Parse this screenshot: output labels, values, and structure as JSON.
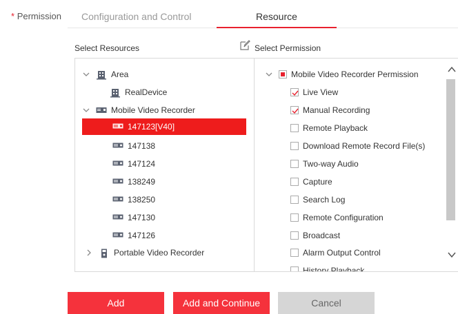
{
  "form": {
    "required_mark": "*",
    "field_label": "Permission"
  },
  "tabs": [
    {
      "label": "Configuration and Control",
      "active": false
    },
    {
      "label": "Resource",
      "active": true
    }
  ],
  "left_panel": {
    "title": "Select Resources",
    "tree": [
      {
        "label": "Area",
        "icon": "area-icon",
        "expanded": true
      },
      {
        "label": "RealDevice",
        "icon": "area-icon"
      },
      {
        "label": "Mobile Video Recorder",
        "icon": "mobile-recorder-icon",
        "expanded": true
      },
      {
        "label": "147123[V40]",
        "icon": "device-icon",
        "selected": true
      },
      {
        "label": "147138",
        "icon": "device-icon"
      },
      {
        "label": "147124",
        "icon": "device-icon"
      },
      {
        "label": "138249",
        "icon": "device-icon"
      },
      {
        "label": "138250",
        "icon": "device-icon"
      },
      {
        "label": "147130",
        "icon": "device-icon"
      },
      {
        "label": "147126",
        "icon": "device-icon"
      },
      {
        "label": "Portable Video Recorder",
        "icon": "portable-recorder-icon",
        "expanded": false
      }
    ]
  },
  "right_panel": {
    "title": "Select Permission",
    "root": {
      "label": "Mobile Video Recorder Permission",
      "state": "partial",
      "expanded": true
    },
    "permissions": [
      {
        "label": "Live View",
        "checked": true
      },
      {
        "label": "Manual Recording",
        "checked": true
      },
      {
        "label": "Remote Playback",
        "checked": false
      },
      {
        "label": "Download Remote Record File(s)",
        "checked": false
      },
      {
        "label": "Two-way Audio",
        "checked": false
      },
      {
        "label": "Capture",
        "checked": false
      },
      {
        "label": "Search Log",
        "checked": false
      },
      {
        "label": "Remote Configuration",
        "checked": false
      },
      {
        "label": "Broadcast",
        "checked": false
      },
      {
        "label": "Alarm Output Control",
        "checked": false
      },
      {
        "label": "History Playback",
        "checked": false
      }
    ]
  },
  "buttons": {
    "add": "Add",
    "add_continue": "Add and Continue",
    "cancel": "Cancel"
  },
  "colors": {
    "accent": "#e8212e",
    "button_primary": "#f5323c",
    "selected_row": "#ee1c1c",
    "button_disabled": "#d6d6d6"
  }
}
